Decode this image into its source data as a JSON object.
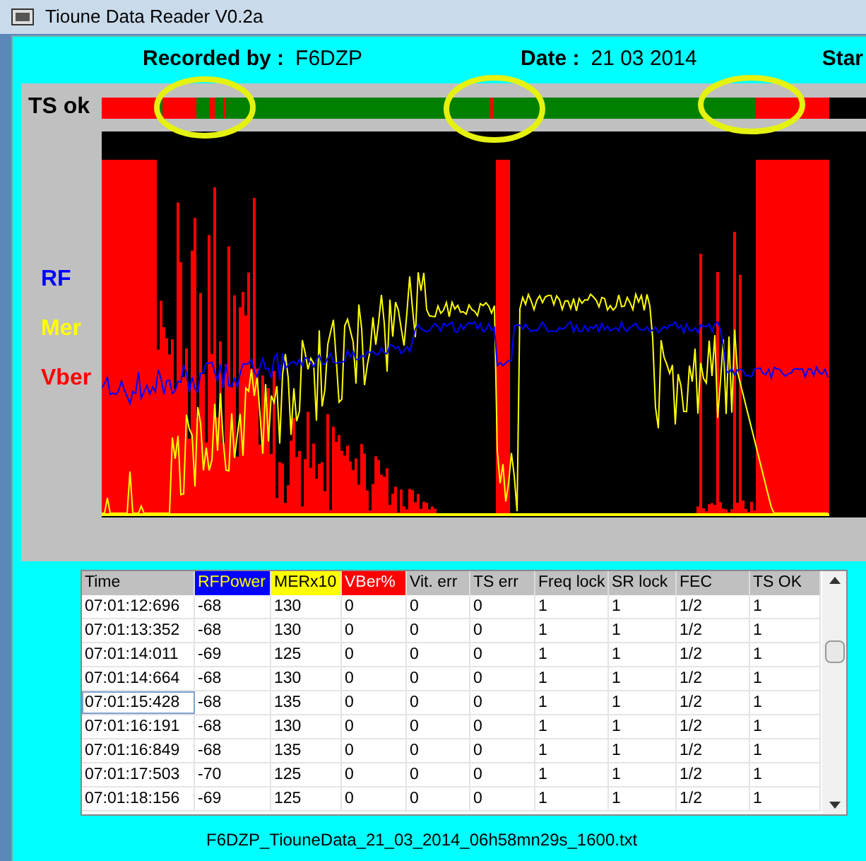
{
  "window": {
    "title": "Tioune Data Reader V0.2a"
  },
  "header": {
    "recorded_by_label": "Recorded by :",
    "recorded_by": "F6DZP",
    "date_label": "Date :",
    "date": "21 03 2014",
    "start_label": "Star"
  },
  "ts_label": "TS ok",
  "legend": [
    {
      "label": "RF",
      "color": "#0000ff"
    },
    {
      "label": "Mer",
      "color": "#ffff00"
    },
    {
      "label": "Vber",
      "color": "#ff0000"
    }
  ],
  "table": {
    "columns": [
      {
        "label": "Time"
      },
      {
        "label": "RFPower",
        "color": "#0000ff"
      },
      {
        "label": "MERx10",
        "color": "#ffff00"
      },
      {
        "label": "VBer%",
        "color": "#ff0000"
      },
      {
        "label": "Vit. err"
      },
      {
        "label": "TS err"
      },
      {
        "label": "Freq lock"
      },
      {
        "label": "SR lock"
      },
      {
        "label": "FEC"
      },
      {
        "label": "TS OK"
      }
    ],
    "rows": [
      {
        "selected": false,
        "cells": [
          "07:01:12:696",
          "-68",
          "130",
          "0",
          "0",
          "0",
          "1",
          "1",
          "1/2",
          "1"
        ]
      },
      {
        "selected": false,
        "cells": [
          "07:01:13:352",
          "-68",
          "130",
          "0",
          "0",
          "0",
          "1",
          "1",
          "1/2",
          "1"
        ]
      },
      {
        "selected": false,
        "cells": [
          "07:01:14:011",
          "-69",
          "125",
          "0",
          "0",
          "0",
          "1",
          "1",
          "1/2",
          "1"
        ]
      },
      {
        "selected": false,
        "cells": [
          "07:01:14:664",
          "-68",
          "130",
          "0",
          "0",
          "0",
          "1",
          "1",
          "1/2",
          "1"
        ]
      },
      {
        "selected": true,
        "cells": [
          "07:01:15:428",
          "-68",
          "135",
          "0",
          "0",
          "0",
          "1",
          "1",
          "1/2",
          "1"
        ]
      },
      {
        "selected": false,
        "cells": [
          "07:01:16:191",
          "-68",
          "130",
          "0",
          "0",
          "0",
          "1",
          "1",
          "1/2",
          "1"
        ]
      },
      {
        "selected": false,
        "cells": [
          "07:01:16:849",
          "-68",
          "135",
          "0",
          "0",
          "0",
          "1",
          "1",
          "1/2",
          "1"
        ]
      },
      {
        "selected": false,
        "cells": [
          "07:01:17:503",
          "-70",
          "125",
          "0",
          "0",
          "0",
          "1",
          "1",
          "1/2",
          "1"
        ]
      },
      {
        "selected": false,
        "cells": [
          "07:01:18:156",
          "-69",
          "125",
          "0",
          "0",
          "0",
          "1",
          "1",
          "1/2",
          "1"
        ]
      }
    ]
  },
  "filename": "F6DZP_TiouneData_21_03_2014_06h58mn29s_1600.txt"
}
